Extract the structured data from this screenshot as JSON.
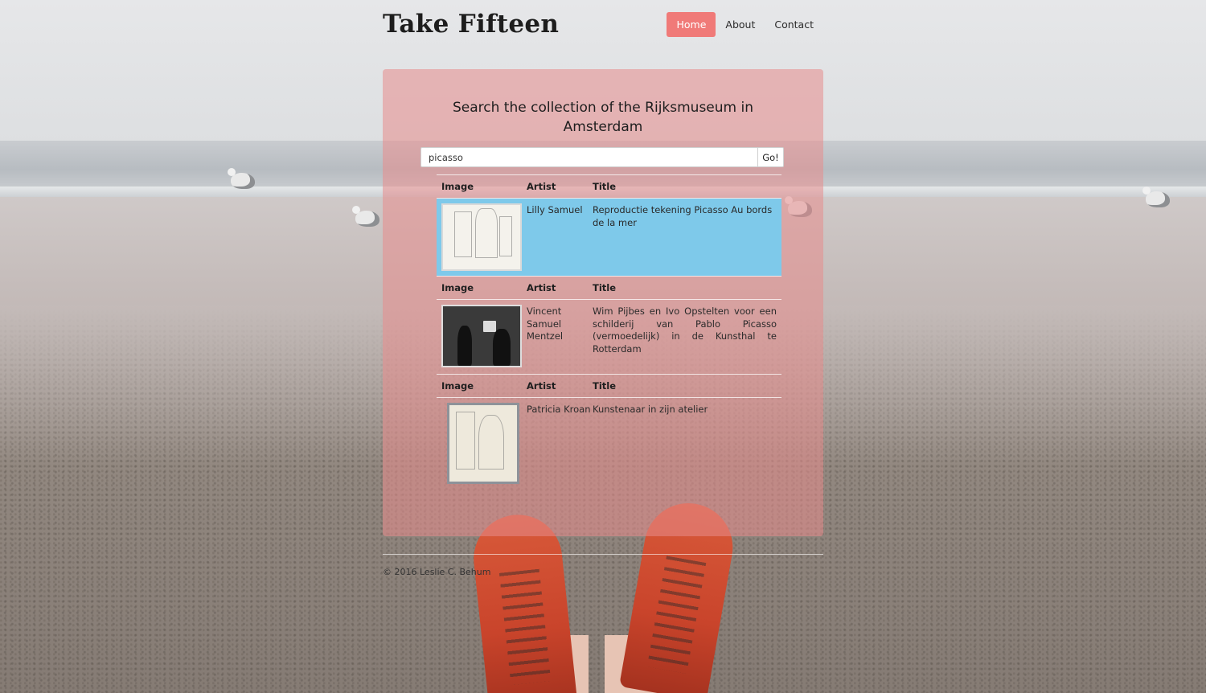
{
  "site": {
    "title": "Take Fifteen"
  },
  "nav": [
    {
      "label": "Home",
      "active": true
    },
    {
      "label": "About",
      "active": false
    },
    {
      "label": "Contact",
      "active": false
    }
  ],
  "main": {
    "heading": "Search the collection of the Rijksmuseum in Amsterdam",
    "search": {
      "value": "picasso",
      "button_label": "Go!"
    },
    "columns": [
      "Image",
      "Artist",
      "Title"
    ],
    "results": [
      {
        "artist": "Lilly Samuel",
        "title": "Reproductie tekening Picasso Au bords de la mer",
        "selected": true
      },
      {
        "artist": "Vincent Samuel Mentzel",
        "title": "Wim Pijbes en Ivo Opstelten voor een schilderij van Pablo Picasso (vermoedelijk) in de Kunsthal te Rotterdam",
        "selected": false
      },
      {
        "artist": "Patricia Kroan",
        "title": "Kunstenaar in zijn atelier",
        "selected": false
      }
    ]
  },
  "footer": {
    "text": "© 2016 Leslie C. Behum"
  },
  "colors": {
    "nav_active": "#f07a78",
    "card_tint": "#e88c8c",
    "row_selected": "#7ec9ea"
  }
}
